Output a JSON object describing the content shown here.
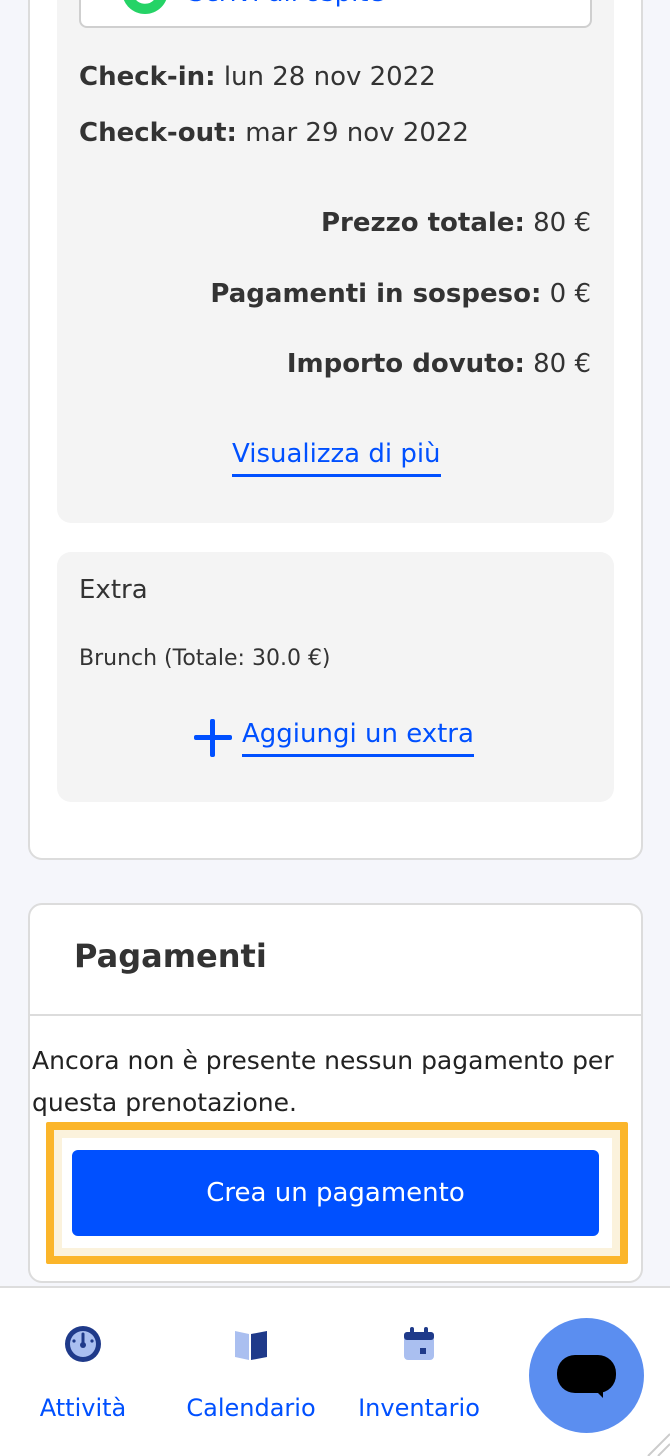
{
  "booking": {
    "whatsapp_label": "Scrivi all'ospite",
    "checkin_label": "Check-in:",
    "checkin_value": "lun 28 nov 2022",
    "checkout_label": "Check-out:",
    "checkout_value": "mar 29 nov 2022",
    "total_label": "Prezzo totale:",
    "total_value": "80 €",
    "pending_label": "Pagamenti in sospeso:",
    "pending_value": "0 €",
    "due_label": "Importo dovuto:",
    "due_value": "80 €",
    "show_more": "Visualizza di più"
  },
  "extras": {
    "title": "Extra",
    "items": [
      "Brunch (Totale: 30.0 €)"
    ],
    "add_label": "Aggiungi un extra"
  },
  "payments": {
    "title": "Pagamenti",
    "empty_text": "Ancora non è presente nessun pagamento per questa prenotazione.",
    "create_button": "Crea un pagamento"
  },
  "nav": {
    "items": [
      {
        "label": "Attività",
        "icon": "dashboard-gauge-icon"
      },
      {
        "label": "Calendario",
        "icon": "book-icon"
      },
      {
        "label": "Inventario",
        "icon": "calendar-icon"
      }
    ]
  },
  "colors": {
    "accent": "#0050ff",
    "highlight": "#fbb52a",
    "chat_fab": "#5b8ef0",
    "whatsapp": "#25d366"
  }
}
